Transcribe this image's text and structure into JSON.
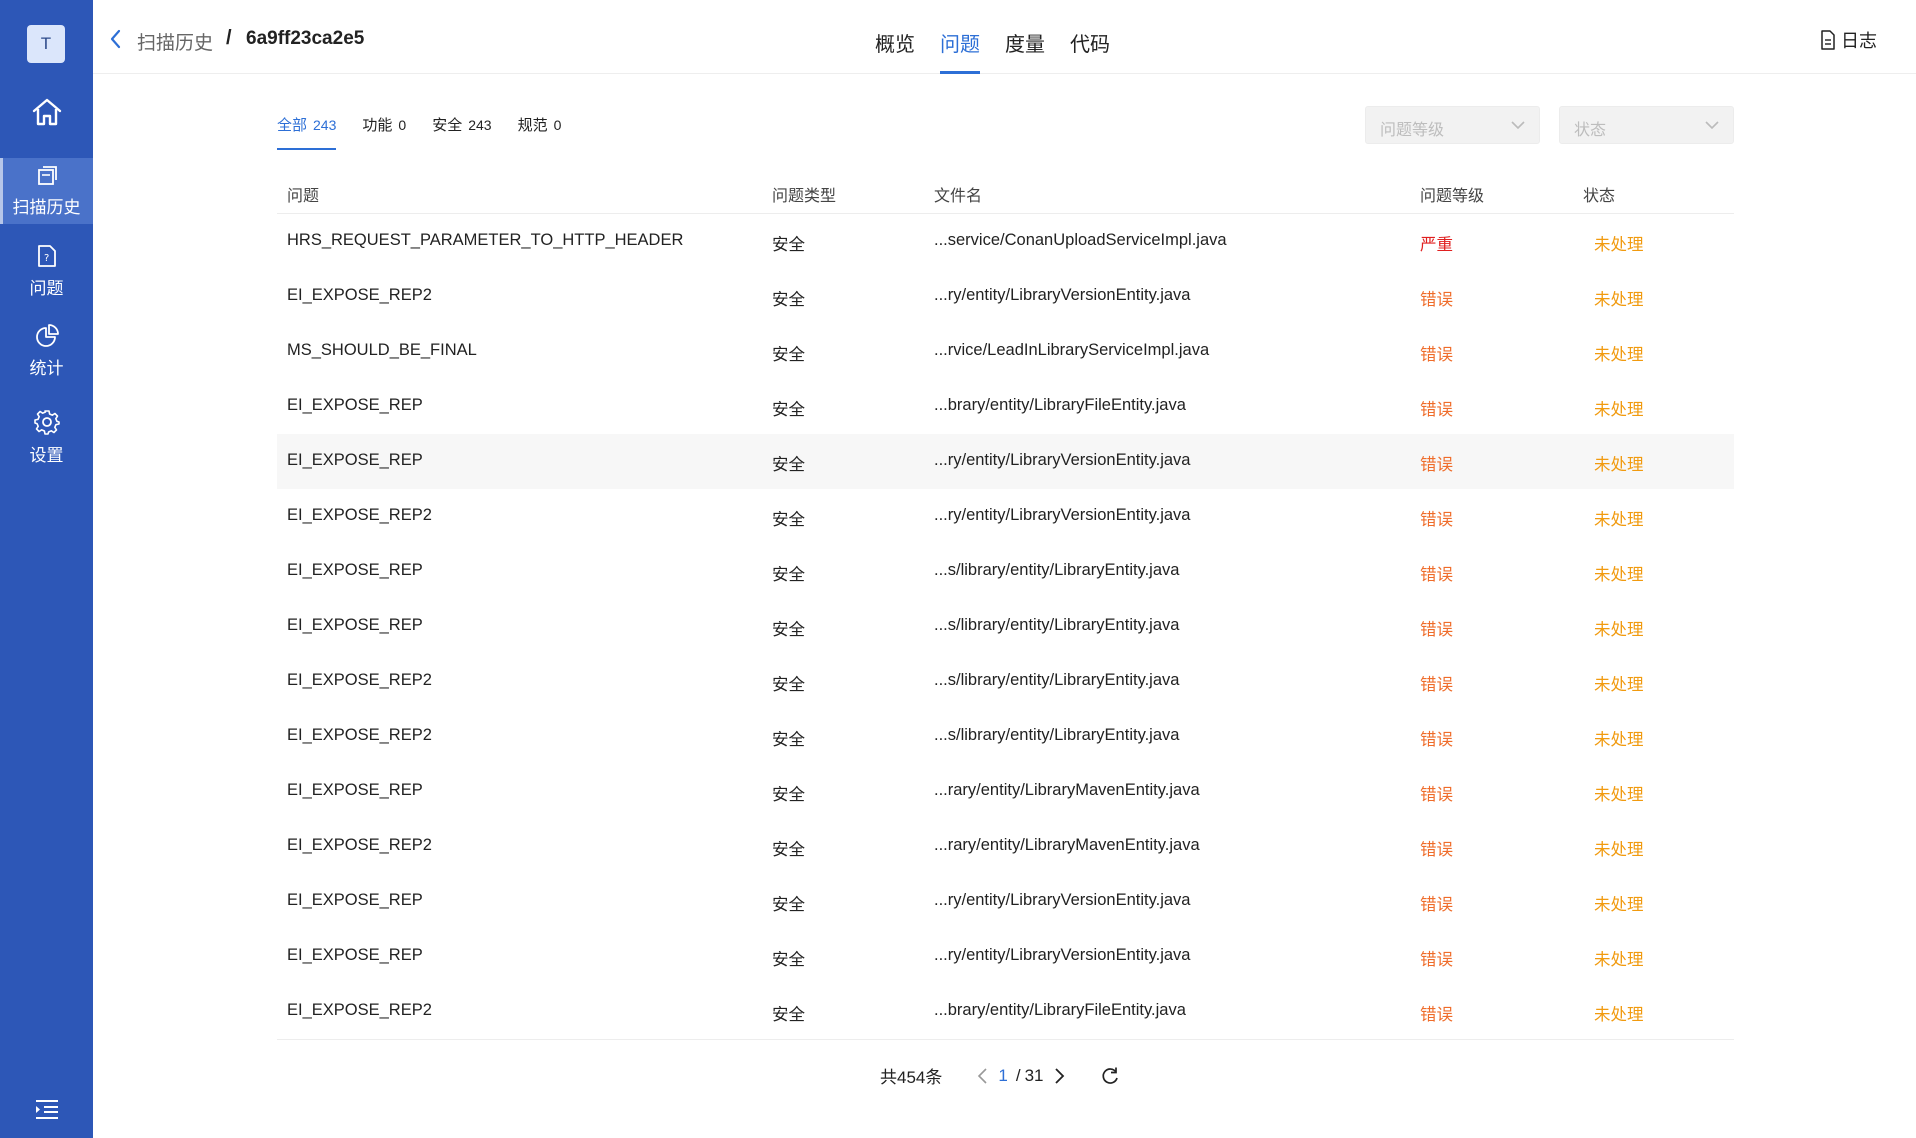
{
  "sidebar": {
    "avatar": "T",
    "items": [
      {
        "label": "扫描历史",
        "icon": "history-icon",
        "active": true
      },
      {
        "label": "问题",
        "icon": "file-question-icon",
        "active": false
      },
      {
        "label": "统计",
        "icon": "pie-chart-icon",
        "active": false
      },
      {
        "label": "设置",
        "icon": "gear-icon",
        "active": false
      }
    ]
  },
  "header": {
    "breadcrumb_parent": "扫描历史",
    "breadcrumb_sep": "/",
    "breadcrumb_current": "6a9ff23ca2e5",
    "tabs": [
      "概览",
      "问题",
      "度量",
      "代码"
    ],
    "active_tab": "问题",
    "log_label": "日志"
  },
  "filters": {
    "sub_tabs": [
      {
        "label": "全部",
        "count": "243"
      },
      {
        "label": "功能",
        "count": "0"
      },
      {
        "label": "安全",
        "count": "243"
      },
      {
        "label": "规范",
        "count": "0"
      }
    ],
    "level_placeholder": "问题等级",
    "status_placeholder": "状态"
  },
  "table": {
    "columns": [
      "问题",
      "问题类型",
      "文件名",
      "问题等级",
      "状态"
    ],
    "rows": [
      [
        "HRS_REQUEST_PARAMETER_TO_HTTP_HEADER",
        "安全",
        "...service/ConanUploadServiceImpl.java",
        "严重",
        "未处理"
      ],
      [
        "EI_EXPOSE_REP2",
        "安全",
        "...ry/entity/LibraryVersionEntity.java",
        "错误",
        "未处理"
      ],
      [
        "MS_SHOULD_BE_FINAL",
        "安全",
        "...rvice/LeadInLibraryServiceImpl.java",
        "错误",
        "未处理"
      ],
      [
        "EI_EXPOSE_REP",
        "安全",
        "...brary/entity/LibraryFileEntity.java",
        "错误",
        "未处理"
      ],
      [
        "EI_EXPOSE_REP",
        "安全",
        "...ry/entity/LibraryVersionEntity.java",
        "错误",
        "未处理"
      ],
      [
        "EI_EXPOSE_REP2",
        "安全",
        "...ry/entity/LibraryVersionEntity.java",
        "错误",
        "未处理"
      ],
      [
        "EI_EXPOSE_REP",
        "安全",
        "...s/library/entity/LibraryEntity.java",
        "错误",
        "未处理"
      ],
      [
        "EI_EXPOSE_REP",
        "安全",
        "...s/library/entity/LibraryEntity.java",
        "错误",
        "未处理"
      ],
      [
        "EI_EXPOSE_REP2",
        "安全",
        "...s/library/entity/LibraryEntity.java",
        "错误",
        "未处理"
      ],
      [
        "EI_EXPOSE_REP2",
        "安全",
        "...s/library/entity/LibraryEntity.java",
        "错误",
        "未处理"
      ],
      [
        "EI_EXPOSE_REP",
        "安全",
        "...rary/entity/LibraryMavenEntity.java",
        "错误",
        "未处理"
      ],
      [
        "EI_EXPOSE_REP2",
        "安全",
        "...rary/entity/LibraryMavenEntity.java",
        "错误",
        "未处理"
      ],
      [
        "EI_EXPOSE_REP",
        "安全",
        "...ry/entity/LibraryVersionEntity.java",
        "错误",
        "未处理"
      ],
      [
        "EI_EXPOSE_REP",
        "安全",
        "...ry/entity/LibraryVersionEntity.java",
        "错误",
        "未处理"
      ],
      [
        "EI_EXPOSE_REP2",
        "安全",
        "...brary/entity/LibraryFileEntity.java",
        "错误",
        "未处理"
      ]
    ]
  },
  "pagination": {
    "total": "共454条",
    "current": "1",
    "sep": "/",
    "pages": "31"
  },
  "colors": {
    "sidebar": "#2d57b7",
    "accent": "#2d6fd6",
    "severe": "#e02020",
    "error": "#ef6c2a",
    "pending": "#f19a0e"
  }
}
